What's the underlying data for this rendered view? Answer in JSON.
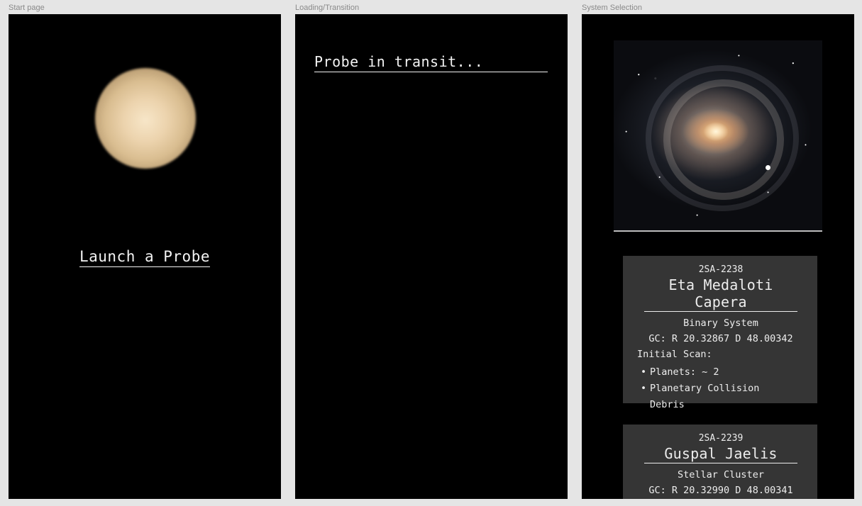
{
  "frames": {
    "start": {
      "label": "Start page",
      "launch_label": "Launch a Probe"
    },
    "loading": {
      "label": "Loading/Transition",
      "transit_text": "Probe in transit..."
    },
    "selection": {
      "label": "System Selection",
      "systems": [
        {
          "id": "2SA-2238",
          "name": "Eta Medaloti Capera",
          "type": "Binary System",
          "coords": "GC: R 20.32867 D 48.00342",
          "scan_label": "Initial Scan:",
          "scan_items": [
            "Planets: ~ 2",
            "Planetary Collision Debris"
          ]
        },
        {
          "id": "2SA-2239",
          "name": "Guspal Jaelis",
          "type": "Stellar Cluster",
          "coords": "GC: R 20.32990 D 48.00341"
        }
      ]
    }
  },
  "colors": {
    "canvas": "#e5e5e5",
    "frame_bg": "#000000",
    "card_bg": "#353535",
    "text": "#f3f3f3",
    "label": "#8a8a8a"
  }
}
